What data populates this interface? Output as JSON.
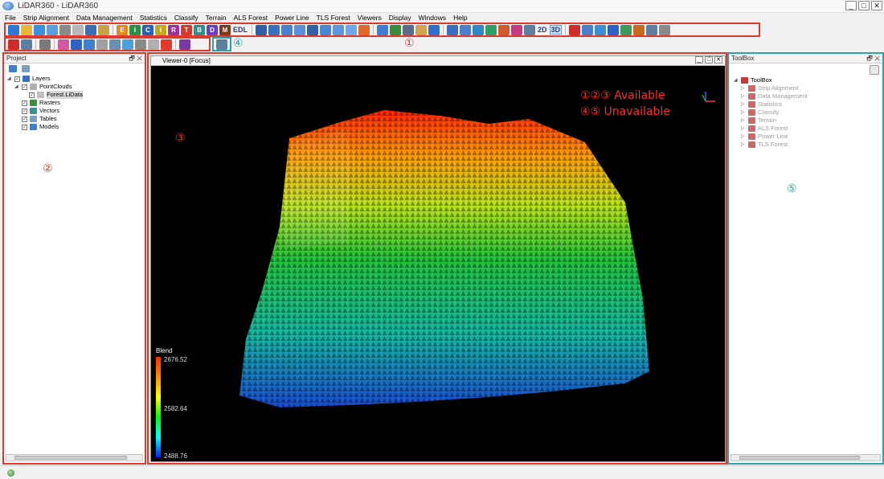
{
  "window": {
    "title": "LiDAR360 - LiDAR360"
  },
  "window_buttons": {
    "minimize": "_",
    "maximize": "□",
    "close": "✕"
  },
  "menu": [
    "File",
    "Strip Alignment",
    "Data Management",
    "Statistics",
    "Classify",
    "Terrain",
    "ALS Forest",
    "Power Line",
    "TLS Forest",
    "Viewers",
    "Display",
    "Windows",
    "Help"
  ],
  "toolbar1": {
    "left_icons": [
      "#2a7ad6",
      "#e8b43a",
      "#3d8ee0",
      "#5aa0e0",
      "#8a8a8a",
      "#b8b8b8",
      "#3b6fb8",
      "#c9a045"
    ],
    "class_icons": [
      {
        "letter": "E",
        "color": "#e08a1e"
      },
      {
        "letter": "I",
        "color": "#2c8e46"
      },
      {
        "letter": "C",
        "color": "#2a62b8"
      },
      {
        "letter": "I",
        "color": "#c3a71a"
      },
      {
        "letter": "R",
        "color": "#9b2f9b"
      },
      {
        "letter": "T",
        "color": "#d33a2c"
      },
      {
        "letter": "B",
        "color": "#2f8f8f"
      },
      {
        "letter": "D",
        "color": "#6b3fbf"
      },
      {
        "letter": "M",
        "color": "#7a3a1a"
      }
    ],
    "edl_label": "EDL",
    "view_icons": [
      "#2e5fa8",
      "#3a6fc0",
      "#4a7fd0",
      "#5a8fe0",
      "#3260a6",
      "#4a86d6",
      "#5c98e2",
      "#6fa8ea",
      "#e06a2a"
    ],
    "nav_icons": [
      "#3b7dd8",
      "#3a8a3a",
      "#5a6c8a",
      "#d4a24c",
      "#2f6fd2"
    ],
    "display_icons": [
      "#3a6fc0",
      "#4a7fd0",
      "#2f88c8",
      "#2f9f6a",
      "#d25a2a",
      "#c23b84",
      "#5f7fa0"
    ],
    "mode_2d": "2D",
    "mode_3d": "3D",
    "tool_icons": [
      "#d02a2a",
      "#4a7fd0",
      "#3a8fd6",
      "#2a62c8",
      "#3a9a5a",
      "#c86a1a",
      "#5a7fa0",
      "#8a8a8a"
    ]
  },
  "toolbar2": {
    "edit_icons": [
      "#d02a2a",
      "#5a7fa0",
      "#7a7a7a",
      "#d25aa0",
      "#2a62c8",
      "#3a7fd0",
      "#a0a0a0",
      "#6a8fb0",
      "#4aa0d8",
      "#8a8a8a",
      "#b0b0b0",
      "#e03a2a",
      "#7a3aa0"
    ],
    "unavailable_icon": "#5f7f9f"
  },
  "markers": {
    "m1": "①",
    "m2": "②",
    "m3": "③",
    "m4": "④",
    "m5": "⑤"
  },
  "project_panel": {
    "title": "Project",
    "header_buttons": "🗗 ✕",
    "tree": [
      {
        "label": "Layers",
        "level": 0,
        "arrow": "◢",
        "checked": true,
        "icon": "#3a6fc0"
      },
      {
        "label": "PointClouds",
        "level": 1,
        "arrow": "◢",
        "checked": true,
        "icon": "#b0b0b0"
      },
      {
        "label": "Forest.LiData",
        "level": 2,
        "arrow": "",
        "checked": true,
        "icon": "#c0c0c0",
        "selected": true
      },
      {
        "label": "Rasters",
        "level": 1,
        "arrow": "",
        "checked": true,
        "icon": "#3a8f3a"
      },
      {
        "label": "Vectors",
        "level": 1,
        "arrow": "",
        "checked": true,
        "icon": "#3a8f8f"
      },
      {
        "label": "Tables",
        "level": 1,
        "arrow": "",
        "checked": true,
        "icon": "#7a9fbf"
      },
      {
        "label": "Models",
        "level": 1,
        "arrow": "",
        "checked": true,
        "icon": "#3a7fd0"
      }
    ]
  },
  "viewer": {
    "tab_title": "Viewer-0 [Focus]",
    "legend": {
      "title": "Blend",
      "max": "2676.52",
      "mid": "2582.64",
      "min": "2488.76"
    },
    "availability": {
      "available": "①②③ Available",
      "unavailable": "④⑤ Unavailable"
    }
  },
  "toolbox_panel": {
    "title": "ToolBox",
    "header_buttons": "🗗 ✕",
    "root": "ToolBox",
    "items": [
      "Strip Alignment",
      "Data Management",
      "Statistics",
      "Classify",
      "Terrain",
      "ALS Forest",
      "Power Line",
      "TLS Forest"
    ]
  }
}
